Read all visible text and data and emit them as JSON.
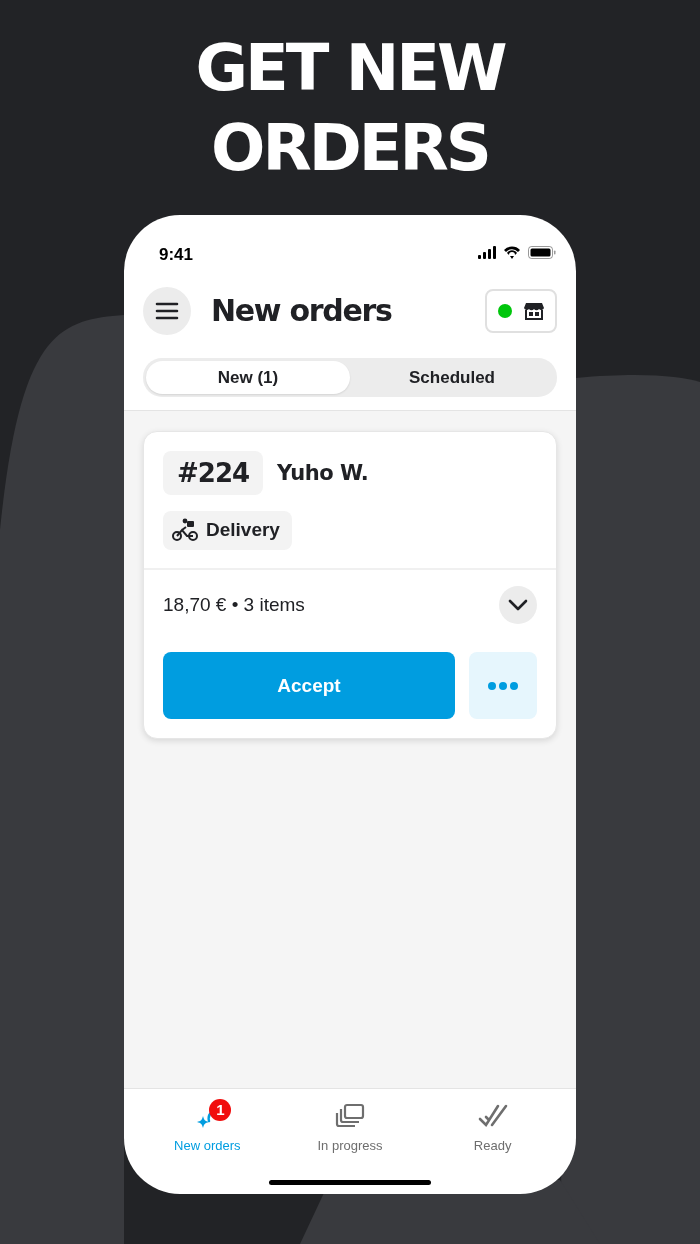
{
  "headline": "GET NEW ORDERS",
  "status_bar": {
    "time": "9:41"
  },
  "header": {
    "title": "New orders",
    "store_online": true
  },
  "tabs": [
    {
      "label": "New (1)",
      "selected": true
    },
    {
      "label": "Scheduled",
      "selected": false
    }
  ],
  "orders": [
    {
      "number": "#224",
      "customer": "Yuho W.",
      "type": "Delivery",
      "summary": "18,70 € • 3 items",
      "expanded": false,
      "primary_action": "Accept"
    }
  ],
  "bottom_nav": [
    {
      "label": "New orders",
      "selected": true,
      "badge": "1"
    },
    {
      "label": "In progress",
      "selected": false
    },
    {
      "label": "Ready",
      "selected": false
    }
  ]
}
